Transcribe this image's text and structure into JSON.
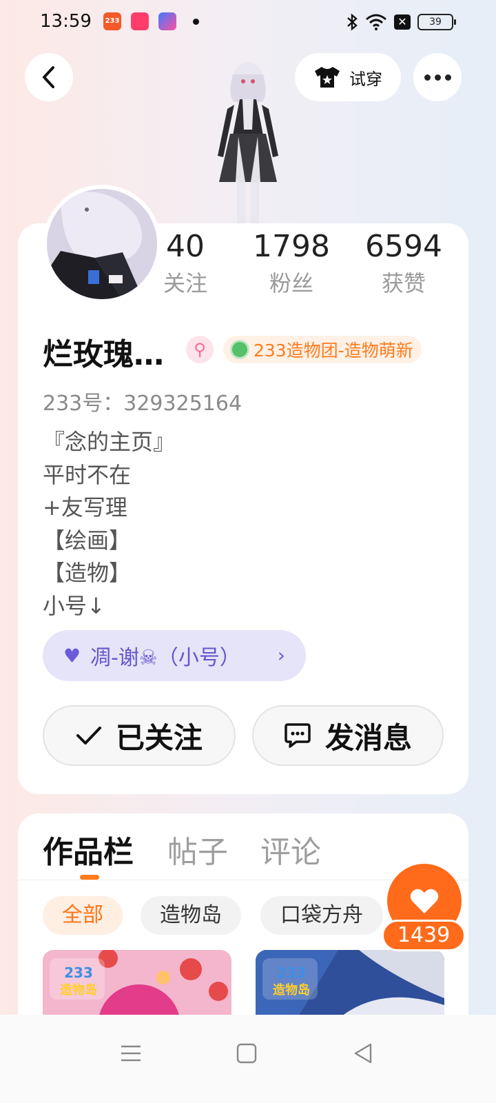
{
  "status_bar": {
    "time": "13:59",
    "battery": "39",
    "app_badge_233": "233"
  },
  "header": {
    "try_on_label": "试穿"
  },
  "profile": {
    "stats": [
      {
        "value": "40",
        "label": "关注"
      },
      {
        "value": "1798",
        "label": "粉丝"
      },
      {
        "value": "6594",
        "label": "获赞"
      }
    ],
    "name": "烂玫瑰…",
    "gender_symbol": "⚲",
    "badge": "233造物团-造物萌新",
    "uid": "233号：329325164",
    "bio": "『念的主页』\n平时不在\n+友写理\n【绘画】\n【造物】\n小号↓",
    "alt_account": "凋-谢☠（小号）",
    "follow_label": "已关注",
    "message_label": "发消息"
  },
  "works": {
    "tabs": [
      "作品栏",
      "帖子",
      "评论"
    ],
    "filters": [
      "全部",
      "造物岛",
      "口袋方舟"
    ],
    "thumb_logo_top": "233",
    "thumb_logo_bottom": "造物岛"
  },
  "like_count": "1439",
  "colors": {
    "accent": "#ff6b1a",
    "alt_account_bg": "#e6e4f9",
    "badge_text": "#ff7b1f"
  }
}
